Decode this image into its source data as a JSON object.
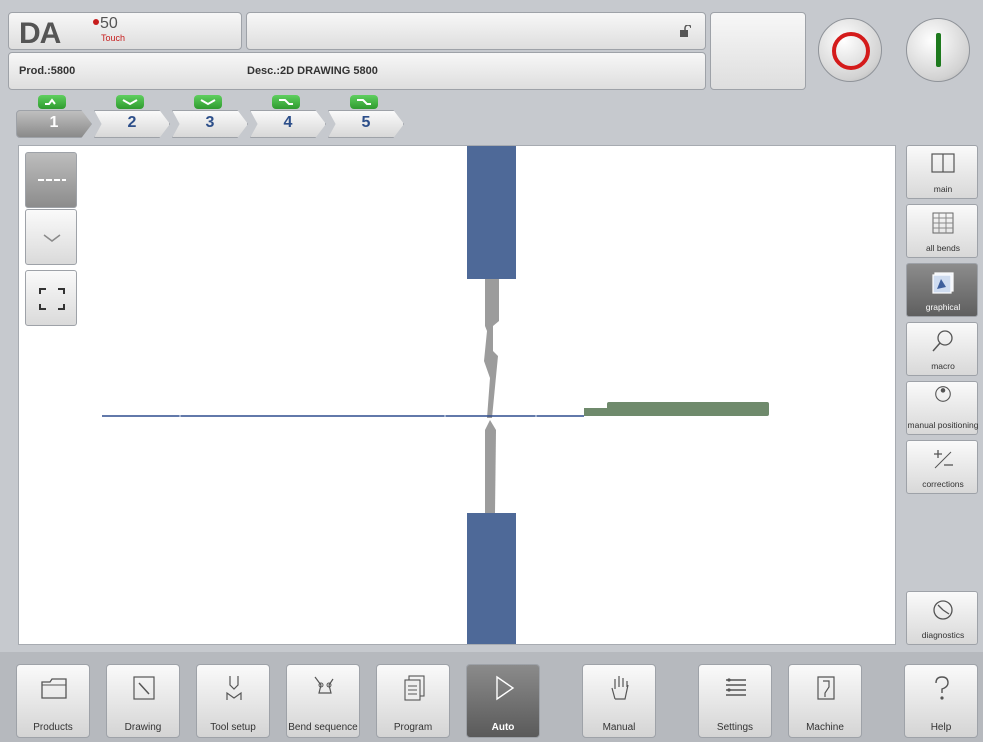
{
  "header": {
    "logo_text": "DA",
    "logo_model": "50",
    "logo_sub": "Touch",
    "prod_label": "Prod.:5800",
    "desc_label": "Desc.:2D DRAWING 5800"
  },
  "steps": [
    {
      "number": "1",
      "active": true,
      "icon": "bend-up-icon"
    },
    {
      "number": "2",
      "active": false,
      "icon": "bend-down-icon"
    },
    {
      "number": "3",
      "active": false,
      "icon": "bend-down-icon"
    },
    {
      "number": "4",
      "active": false,
      "icon": "bend-flat-down-icon"
    },
    {
      "number": "5",
      "active": false,
      "icon": "bend-flat-down-icon"
    }
  ],
  "view_tools": [
    {
      "name": "profile-view",
      "icon": "dashes-icon",
      "active": true
    },
    {
      "name": "side-view",
      "icon": "chevron-down-icon",
      "active": false
    },
    {
      "name": "fit-view",
      "icon": "frame-icon",
      "active": false
    }
  ],
  "right_menu": [
    {
      "label": "main",
      "icon": "main-icon"
    },
    {
      "label": "all bends",
      "icon": "table-icon"
    },
    {
      "label": "graphical",
      "icon": "graphical-icon",
      "active": true
    },
    {
      "label": "macro",
      "icon": "magnifier-icon"
    },
    {
      "label": "manual positioning",
      "icon": "positioning-icon"
    },
    {
      "label": "corrections",
      "icon": "plus-minus-icon"
    },
    {
      "label": "diagnostics",
      "icon": "gauge-icon"
    }
  ],
  "footer": [
    {
      "label": "Products",
      "icon": "folder-icon"
    },
    {
      "label": "Drawing",
      "icon": "pencil-icon"
    },
    {
      "label": "Tool setup",
      "icon": "tool-icon"
    },
    {
      "label": "Bend sequence",
      "icon": "bend-sequence-icon"
    },
    {
      "label": "Program",
      "icon": "pages-icon"
    },
    {
      "label": "Auto",
      "icon": "play-icon",
      "active": true
    },
    {
      "label": "Manual",
      "icon": "hand-icon"
    },
    {
      "label": "Settings",
      "icon": "list-icon"
    },
    {
      "label": "Machine",
      "icon": "machine-icon"
    },
    {
      "label": "Help",
      "icon": "question-icon"
    }
  ],
  "colors": {
    "tool_block": "#4e6998",
    "tool_punch": "#9c9c9c",
    "sheet": "#6f8a6c",
    "bend_line": "#2f4d8d",
    "stop_red": "#d41b1b",
    "start_green": "#1e7a1e"
  }
}
